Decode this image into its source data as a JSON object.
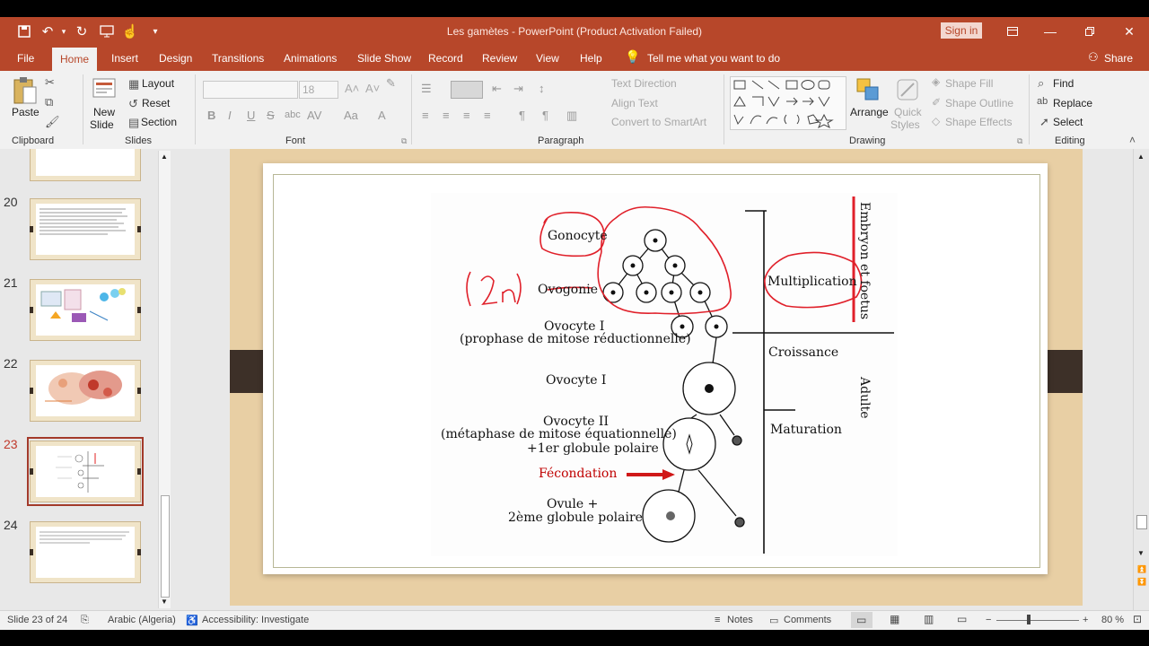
{
  "titlebar": {
    "title": "Les gamètes  -  PowerPoint (Product Activation Failed)",
    "sign_in": "Sign in",
    "qat_icons": [
      "save-icon",
      "undo-icon",
      "redo-icon",
      "present-icon",
      "touch-mode-icon",
      "customize-qat-icon"
    ]
  },
  "tabs": [
    "File",
    "Home",
    "Insert",
    "Design",
    "Transitions",
    "Animations",
    "Slide Show",
    "Record",
    "Review",
    "View",
    "Help"
  ],
  "tell_me": "Tell me what you want to do",
  "share": "Share",
  "ribbon": {
    "clipboard": {
      "paste": "Paste",
      "label": "Clipboard"
    },
    "slides": {
      "new_slide_line1": "New",
      "new_slide_line2": "Slide",
      "layout": "Layout",
      "reset": "Reset",
      "section": "Section",
      "label": "Slides"
    },
    "font": {
      "font_size": "18",
      "label": "Font"
    },
    "paragraph": {
      "text_direction": "Text Direction",
      "align_text": "Align Text",
      "convert_smartart": "Convert to SmartArt",
      "label": "Paragraph"
    },
    "drawing": {
      "arrange": "Arrange",
      "quick_styles_1": "Quick",
      "quick_styles_2": "Styles",
      "shape_fill": "Shape Fill",
      "shape_outline": "Shape Outline",
      "shape_effects": "Shape Effects",
      "label": "Drawing"
    },
    "editing": {
      "find": "Find",
      "replace": "Replace",
      "select": "Select",
      "label": "Editing"
    }
  },
  "thumbnails": [
    {
      "num": "20"
    },
    {
      "num": "21"
    },
    {
      "num": "22"
    },
    {
      "num": "23",
      "selected": true
    },
    {
      "num": "24"
    }
  ],
  "slide": {
    "labels": {
      "gonocyte": "Gonocyte",
      "ovogonie": "Ovogonie",
      "ovocyte1a": "Ovocyte I",
      "prophase": "(prophase de mitose réductionnelle)",
      "ovocyte1b": "Ovocyte I",
      "ovocyte2": "Ovocyte II",
      "metaphase": "(métaphase de mitose équationnelle)",
      "globule1": "+1er globule polaire",
      "fecondation": "Fécondation",
      "ovule": "Ovule +",
      "globule2": "2ème globule polaire",
      "multiplication": "Multiplication",
      "croissance": "Croissance",
      "maturation": "Maturation",
      "embryon": "Embryon et foetus",
      "adulte": "Adulte",
      "annotation_2n": "(2n)"
    },
    "colors": {
      "fecondation": "#c00000",
      "annotation": "#e0202a"
    }
  },
  "status": {
    "slide": "Slide 23 of 24",
    "language": "Arabic (Algeria)",
    "accessibility": "Accessibility: Investigate",
    "notes": "Notes",
    "comments": "Comments",
    "zoom": "80 %"
  }
}
